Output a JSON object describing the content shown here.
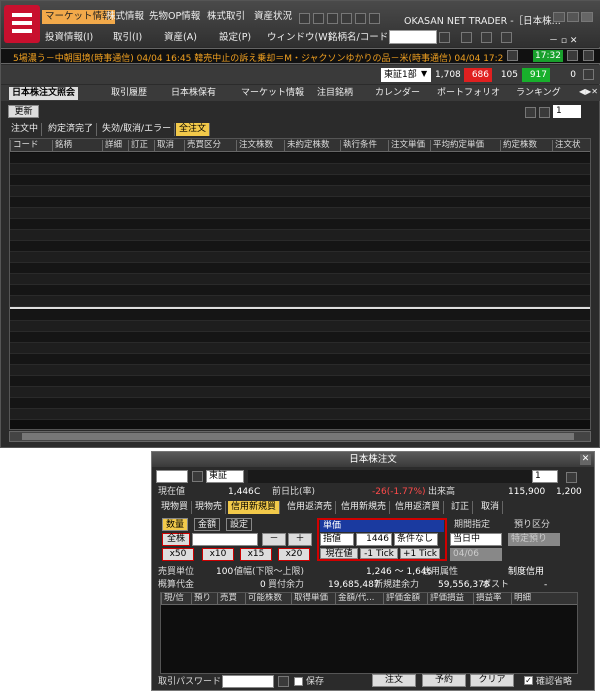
{
  "app": {
    "brand": "OKASAN NET TRADER -［日本株..."
  },
  "menu": {
    "top": [
      "マーケット情報",
      "株式情報",
      "先物OP情報",
      "株式取引",
      "資産状況"
    ],
    "second": [
      "投資情報(I)",
      "取引(I)",
      "資産(A)",
      "設定(P)",
      "ウィンドウ(W)",
      "銘柄名/コード:"
    ]
  },
  "ticker": {
    "text": "5場濃う－中朝国境(時事通信)  04/04 16:45 韓売中止の訴え乗却＝M・ジャクソンゆかりの品－米(時事通信)  04/04 17:28「またも",
    "time": "17:32"
  },
  "index": {
    "exchange": "東証1部",
    "v1": "1,708",
    "v2": "686",
    "v3": "105",
    "v4": "917",
    "v5": "0"
  },
  "tabs": [
    "日本株注文照会",
    "取引履歴",
    "日本株保有",
    "マーケット情報",
    "注目銘柄",
    "カレンダー",
    "ポートフォリオ",
    "ランキング"
  ],
  "toolbar": {
    "refresh": "更新",
    "count": "1"
  },
  "filters": [
    "注文中",
    "約定済完了",
    "失効/取消/エラー",
    "全注文"
  ],
  "grid": {
    "headers": [
      "コード",
      "銘柄",
      "詳細",
      "訂正",
      "取消",
      "売買区分",
      "注文株数",
      "未約定株数",
      "執行条件",
      "注文単価",
      "平均約定単価",
      "約定株数",
      "注文状"
    ]
  },
  "order": {
    "title": "日本株注文",
    "exchange": "東証",
    "count": "1",
    "price_label": "現在値",
    "price": "1,446",
    "price_c": "C",
    "change_label": "前日比(率)",
    "change": "-26(-1.77%)",
    "volume_label": "出来高",
    "volume": "115,900",
    "lot": "1,200",
    "tabs": [
      "現物買",
      "現物売",
      "信用新規買",
      "信用返済売",
      "信用新規売",
      "信用返済買",
      "訂正",
      "取消"
    ],
    "qty_tabs": [
      "数量",
      "金額",
      "設定"
    ],
    "all": "全株",
    "minus": "－",
    "plus": "＋",
    "mult": [
      "x50",
      "x10",
      "x15",
      "x20"
    ],
    "unit_label": "単価",
    "price_type": "指値",
    "unit_price": "1446",
    "cond": "条件なし",
    "cur_btn": "現在値",
    "minus_tick": "-1 Tick",
    "plus_tick": "+1 Tick",
    "period_label": "期間指定",
    "period": "当日中",
    "date": "04/06",
    "deposit_label": "預り区分",
    "deposit": "特定預り",
    "trade_unit_label": "売買単位",
    "trade_unit": "100",
    "range_label": "値幅(下限～上限)",
    "range": "1,246 〜 1,646",
    "credit_label": "信用属性",
    "credit": "制度信用",
    "cost_label": "概算代金",
    "cost": "0",
    "buy_label": "買付余力",
    "buy": "19,685,487",
    "new_label": "新規建余力",
    "new": "59,556,378",
    "post_label": "ポスト",
    "post": "-",
    "grid_headers": [
      "現/信",
      "預り",
      "売買",
      "可能株数",
      "取得単価",
      "金額/代...",
      "評価金額",
      "評価損益",
      "損益率",
      "明細"
    ],
    "pw_label": "取引パスワード",
    "save": "保存",
    "submit": "注文",
    "reserve": "予約",
    "clear": "クリア",
    "confirm": "確認省略"
  }
}
